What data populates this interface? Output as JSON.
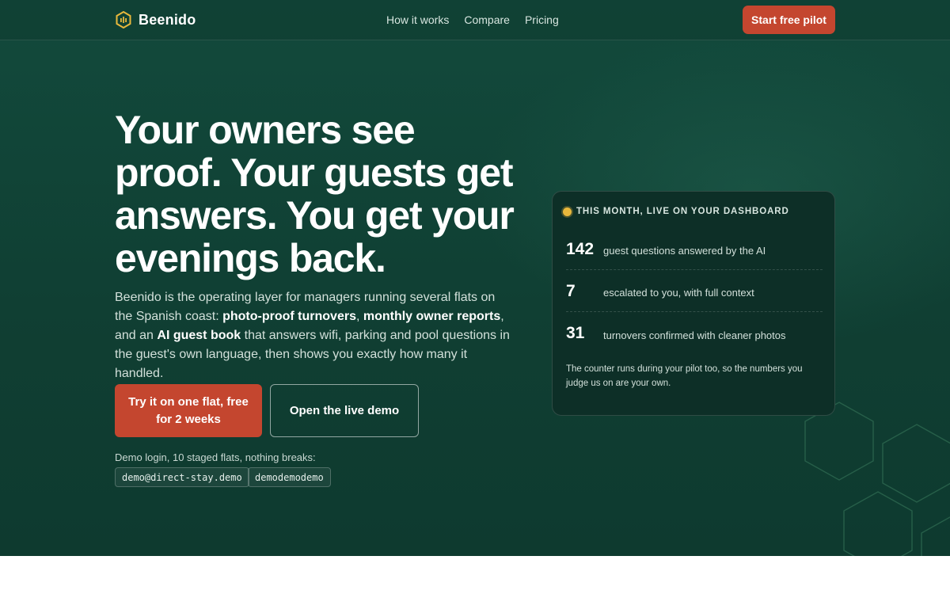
{
  "brand": {
    "name": "Beenido",
    "accent": "#c4462f",
    "background": "#124a3c",
    "dot": "#e8b83c"
  },
  "nav": {
    "items": [
      {
        "label": "How it works"
      },
      {
        "label": "Compare"
      },
      {
        "label": "Pricing"
      }
    ],
    "cta_label": "Start free pilot"
  },
  "hero": {
    "headline": "Your owners see proof. Your guests get answers. You get your evenings back.",
    "lede": {
      "part1": "Beenido is the operating layer for managers running several flats on the Spanish coast: ",
      "bold1": "photo-proof turnovers",
      "part2": ", ",
      "bold2": "monthly owner reports",
      "part3": ", and an ",
      "bold3": "AI guest book",
      "part4": " that answers wifi, parking and pool questions in the guest's own language, then shows you exactly how many it handled."
    },
    "primary_cta": "Try it on one flat, free for 2 weeks",
    "secondary_cta": "Open the live demo",
    "demo_note": "Demo login, 10 staged flats, nothing breaks:",
    "demo_email": "demo@direct-stay.demo",
    "demo_password": "demodemodemo"
  },
  "dashboard_card": {
    "kicker": "THIS MONTH, LIVE ON YOUR DASHBOARD",
    "stats": [
      {
        "value": "142",
        "label": "guest questions answered by the AI"
      },
      {
        "value": "7",
        "label": "escalated to you, with full context"
      },
      {
        "value": "31",
        "label": "turnovers confirmed with cleaner photos"
      }
    ],
    "footnote": "The counter runs during your pilot too, so the numbers you judge us on are your own."
  },
  "icons": {
    "logo": "hexagon-bars-icon",
    "status": "live-dot-icon",
    "decoration": "hexagon-pattern-icon"
  }
}
